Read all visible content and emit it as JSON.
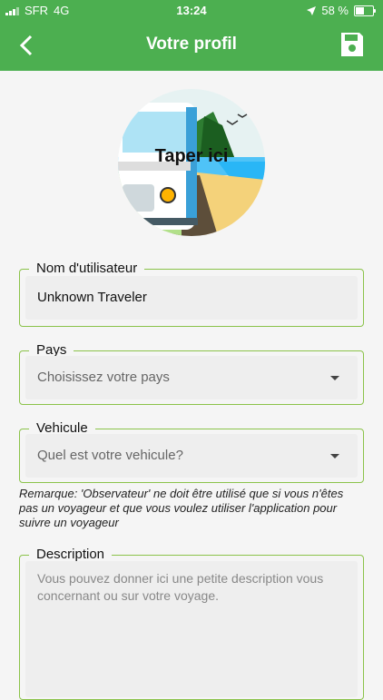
{
  "status_bar": {
    "carrier": "SFR",
    "network": "4G",
    "time": "13:24",
    "battery": "58 %",
    "battery_level": 0.58
  },
  "header": {
    "title": "Votre profil",
    "back_icon": "chevron-left-icon",
    "save_icon": "floppy-disk-icon"
  },
  "avatar": {
    "label": "Taper ici"
  },
  "form": {
    "username": {
      "label": "Nom d'utilisateur",
      "value": "Unknown Traveler"
    },
    "country": {
      "label": "Pays",
      "placeholder": "Choisissez votre pays"
    },
    "vehicle": {
      "label": "Vehicule",
      "placeholder": "Quel est votre vehicule?"
    },
    "note": "Remarque: 'Observateur' ne doit être utilisé que si vous n'êtes pas un voyageur et que vous voulez utiliser l'application pour suivre un voyageur",
    "description": {
      "label": "Description",
      "placeholder": "Vous pouvez donner ici une petite description vous concernant ou sur votre voyage."
    }
  },
  "colors": {
    "accent": "#4caf50",
    "border": "#8bc34a"
  }
}
